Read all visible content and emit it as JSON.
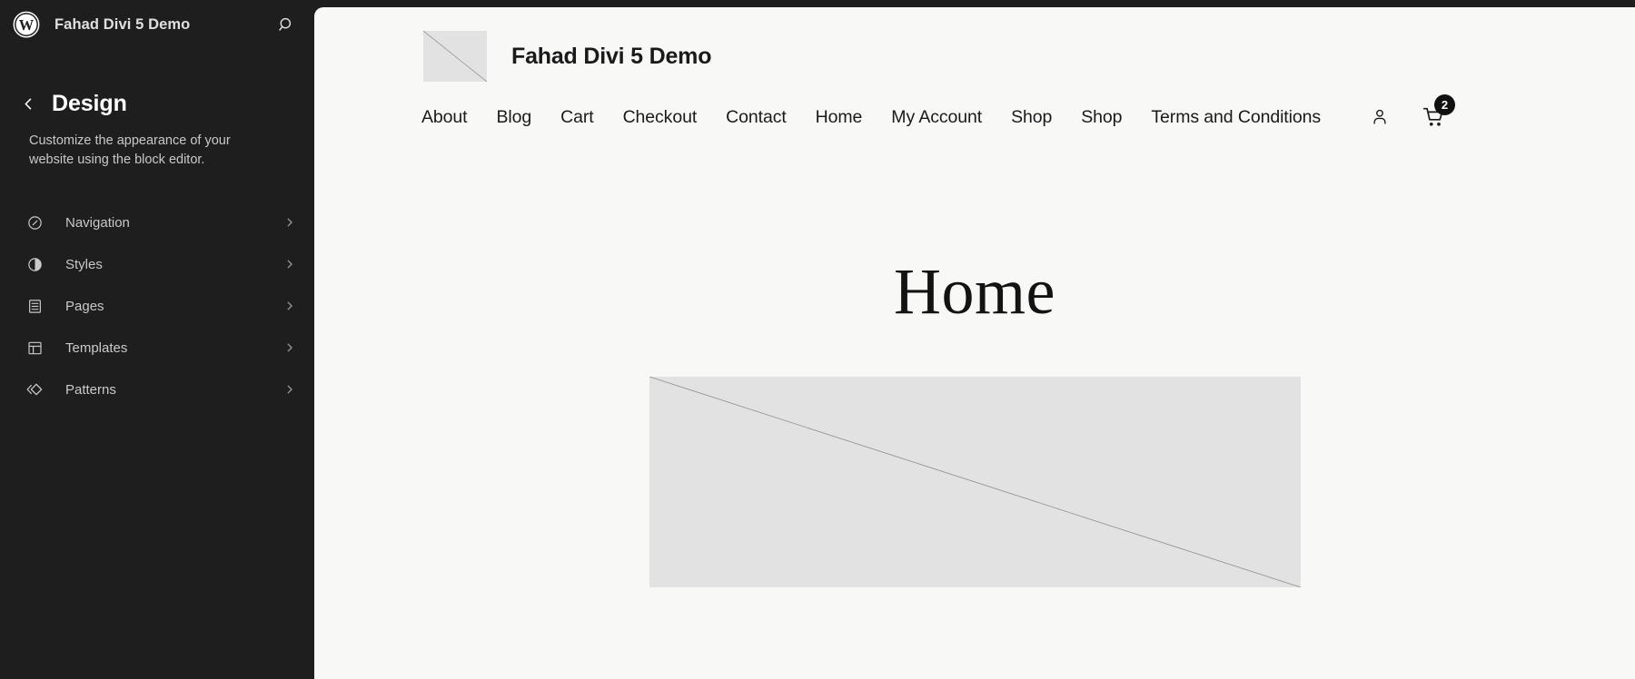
{
  "sidebar": {
    "logo_icon": "wordpress-logo-icon",
    "site_title": "Fahad Divi 5 Demo",
    "search_icon": "search-icon",
    "back_icon": "chevron-left-icon",
    "panel_title": "Design",
    "panel_description": "Customize the appearance of your website using the block editor.",
    "items": [
      {
        "label": "Navigation",
        "icon": "compass-icon",
        "chevron": "chevron-right-icon"
      },
      {
        "label": "Styles",
        "icon": "contrast-half-circle-icon",
        "chevron": "chevron-right-icon"
      },
      {
        "label": "Pages",
        "icon": "page-document-icon",
        "chevron": "chevron-right-icon"
      },
      {
        "label": "Templates",
        "icon": "layout-template-icon",
        "chevron": "chevron-right-icon"
      },
      {
        "label": "Patterns",
        "icon": "patterns-diamond-icon",
        "chevron": "chevron-right-icon"
      }
    ]
  },
  "preview": {
    "brand_name": "Fahad Divi 5 Demo",
    "brand_logo_icon": "image-placeholder-icon",
    "menu": [
      {
        "label": "About"
      },
      {
        "label": "Blog"
      },
      {
        "label": "Cart"
      },
      {
        "label": "Checkout"
      },
      {
        "label": "Contact"
      },
      {
        "label": "Home"
      },
      {
        "label": "My Account"
      },
      {
        "label": "Shop"
      },
      {
        "label": "Shop"
      },
      {
        "label": "Terms and Conditions"
      }
    ],
    "account_icon": "user-account-icon",
    "cart_icon": "shopping-cart-icon",
    "cart_count": "2",
    "page_title": "Home",
    "hero_image_icon": "image-placeholder-icon"
  },
  "colors": {
    "sidebar_bg": "#1e1e1e",
    "canvas_bg": "#f8f8f7",
    "placeholder_gray": "#e2e2e2",
    "text_light": "#c9c9c9",
    "badge_bg": "#111111"
  }
}
